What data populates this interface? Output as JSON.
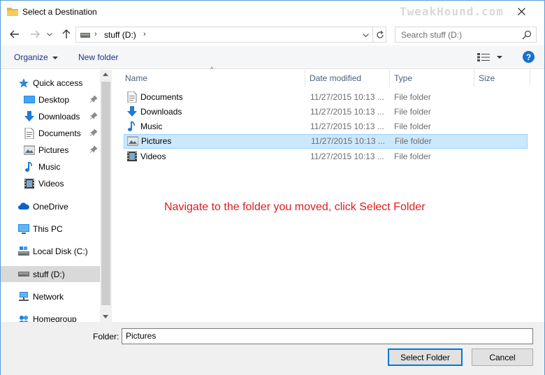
{
  "window": {
    "title": "Select a Destination",
    "watermark": "TweakHound.com"
  },
  "address": {
    "path_segment": "stuff (D:)",
    "search_placeholder": "Search stuff (D:)"
  },
  "toolbar": {
    "organize_label": "Organize",
    "new_folder_label": "New folder",
    "help_label": "?"
  },
  "sidebar": {
    "items": [
      {
        "label": "Quick access",
        "icon": "star-icon",
        "pinned": false
      },
      {
        "label": "Desktop",
        "icon": "desktop-icon",
        "pinned": true
      },
      {
        "label": "Downloads",
        "icon": "download-icon",
        "pinned": true
      },
      {
        "label": "Documents",
        "icon": "document-icon",
        "pinned": true
      },
      {
        "label": "Pictures",
        "icon": "pictures-icon",
        "pinned": true
      },
      {
        "label": "Music",
        "icon": "music-icon",
        "pinned": false
      },
      {
        "label": "Videos",
        "icon": "video-icon",
        "pinned": false
      },
      {
        "label": "OneDrive",
        "icon": "cloud-icon",
        "pinned": false
      },
      {
        "label": "This PC",
        "icon": "computer-icon",
        "pinned": false
      },
      {
        "label": "Local Disk (C:)",
        "icon": "disk-icon",
        "pinned": false
      },
      {
        "label": "stuff (D:)",
        "icon": "drive-icon",
        "pinned": false,
        "selected": true
      },
      {
        "label": "Network",
        "icon": "network-icon",
        "pinned": false
      },
      {
        "label": "Homegroup",
        "icon": "homegroup-icon",
        "pinned": false
      }
    ]
  },
  "table": {
    "columns": [
      "Name",
      "Date modified",
      "Type",
      "Size"
    ],
    "rows": [
      {
        "name": "Documents",
        "date": "11/27/2015 10:13 ...",
        "type": "File folder",
        "icon": "document-icon"
      },
      {
        "name": "Downloads",
        "date": "11/27/2015 10:13 ...",
        "type": "File folder",
        "icon": "download-icon"
      },
      {
        "name": "Music",
        "date": "11/27/2015 10:13 ...",
        "type": "File folder",
        "icon": "music-icon"
      },
      {
        "name": "Pictures",
        "date": "11/27/2015 10:13 ...",
        "type": "File folder",
        "icon": "pictures-icon",
        "selected": true
      },
      {
        "name": "Videos",
        "date": "11/27/2015 10:13 ...",
        "type": "File folder",
        "icon": "video-icon"
      }
    ]
  },
  "annotation": "Navigate to the folder you moved, click Select Folder",
  "footer": {
    "folder_label": "Folder:",
    "folder_value": "Pictures",
    "select_label": "Select Folder",
    "cancel_label": "Cancel"
  },
  "colors": {
    "accent": "#0078d7",
    "selection": "#cce8ff",
    "annotation": "#e01b1b",
    "link": "#1e3287"
  }
}
